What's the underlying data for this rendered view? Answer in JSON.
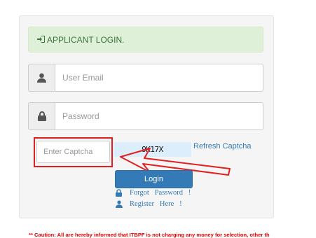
{
  "login": {
    "heading": "APPLICANT LOGIN.",
    "email_placeholder": "User Email",
    "password_placeholder": "Password",
    "captcha_placeholder": "Enter Captcha",
    "captcha_text": "9K17X",
    "refresh_label": "Refresh Captcha",
    "login_label": "Login",
    "forgot_label": "Forgot   Password   !",
    "register_label": "Register   Here   !"
  },
  "caution_text": "** Caution: All are hereby informed that ITBPF is not charging any money for selection, other th",
  "icons": [
    "sign-in-icon",
    "user-icon",
    "lock-icon",
    "lock-icon",
    "user-icon"
  ],
  "colors": {
    "alert_bg": "#dff0d8",
    "alert_text": "#3c763d",
    "primary": "#337ab7",
    "highlight": "#e02020",
    "caution": "#e00000"
  }
}
